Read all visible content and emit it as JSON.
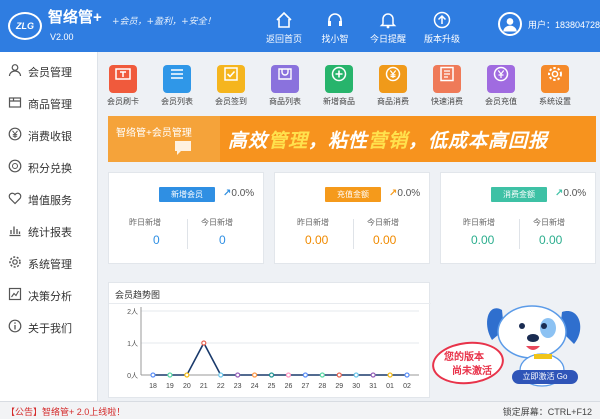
{
  "header": {
    "logo_text": "ZLG",
    "brand": "智络管+",
    "version": "V2.00",
    "slogan": "+会员，+盈利，+安全！",
    "nav": [
      {
        "label": "返回首页",
        "icon": "home-icon"
      },
      {
        "label": "找小智",
        "icon": "headset-icon"
      },
      {
        "label": "今日提醒",
        "icon": "bell-icon"
      },
      {
        "label": "版本升级",
        "icon": "upgrade-icon"
      }
    ],
    "user": "用户：18380472862"
  },
  "sidebar": {
    "items": [
      {
        "label": "会员管理",
        "icon": "person-icon"
      },
      {
        "label": "商品管理",
        "icon": "box-icon"
      },
      {
        "label": "消费收银",
        "icon": "yen-icon"
      },
      {
        "label": "积分兑换",
        "icon": "coin-icon"
      },
      {
        "label": "增值服务",
        "icon": "heart-icon"
      },
      {
        "label": "统计报表",
        "icon": "chart-icon"
      },
      {
        "label": "系统管理",
        "icon": "gear-icon"
      },
      {
        "label": "决策分析",
        "icon": "decision-icon"
      },
      {
        "label": "关于我们",
        "icon": "info-icon"
      }
    ]
  },
  "shortcuts": [
    {
      "label": "会员刷卡",
      "color": "#f05a3c",
      "icon": "card-reader-icon"
    },
    {
      "label": "会员列表",
      "color": "#2f97e8",
      "icon": "list-icon"
    },
    {
      "label": "会员签到",
      "color": "#f5b51e",
      "icon": "checkin-icon"
    },
    {
      "label": "商品列表",
      "color": "#8a72dd",
      "icon": "cart-icon"
    },
    {
      "label": "新增商品",
      "color": "#27b46c",
      "icon": "plus-circle-icon"
    },
    {
      "label": "商品消费",
      "color": "#f09a1a",
      "icon": "yen-circle-icon"
    },
    {
      "label": "快速消费",
      "color": "#ef7a58",
      "icon": "quick-pay-icon"
    },
    {
      "label": "会员充值",
      "color": "#a06be0",
      "icon": "recharge-icon"
    },
    {
      "label": "系统设置",
      "color": "#f58a2a",
      "icon": "settings-icon"
    }
  ],
  "banner": {
    "small": "智络管+会员管理",
    "big_parts": [
      "高效",
      "管理",
      "，粘性",
      "营销",
      "，低成本高回报"
    ]
  },
  "stats": [
    {
      "button": "新增会员",
      "color": "#2f8fe3",
      "pct": "0.0%",
      "yesterday_label": "昨日新增",
      "today_label": "今日新增",
      "yesterday": "0",
      "today": "0",
      "value_color": "#2f8fe3"
    },
    {
      "button": "充值金额",
      "color": "#f59a1b",
      "pct": "0.0%",
      "yesterday_label": "昨日新增",
      "today_label": "今日新增",
      "yesterday": "0.00",
      "today": "0.00",
      "value_color": "#f08a00"
    },
    {
      "button": "消费金额",
      "color": "#3ec1a5",
      "pct": "0.0%",
      "yesterday_label": "昨日新增",
      "today_label": "今日新增",
      "yesterday": "0.00",
      "today": "0.00",
      "value_color": "#2cae8e"
    }
  ],
  "mascot": {
    "line1": "您的版本",
    "line2": "尚未激活",
    "button": "立即激活 Go"
  },
  "footer": {
    "notice": "【公告】智络管+ 2.0上线啦！",
    "lock": "锁定屏幕：CTRL+F12"
  },
  "chart_data": {
    "type": "line",
    "title": "会员趋势图",
    "x": [
      "18",
      "19",
      "20",
      "21",
      "22",
      "23",
      "24",
      "25",
      "26",
      "27",
      "28",
      "29",
      "30",
      "31",
      "01",
      "02"
    ],
    "series": [
      {
        "values": [
          0,
          0,
          0,
          1,
          0,
          0,
          0,
          0,
          0,
          0,
          0,
          0,
          0,
          0,
          0,
          0
        ],
        "color": "#1a3a6b"
      }
    ],
    "point_colors": [
      "#5b8ff9",
      "#5ad8a6",
      "#f6bd16",
      "#e86452",
      "#6dc8ec",
      "#945fb9",
      "#ff9845",
      "#1e9493",
      "#ff99c3",
      "#5b8ff9",
      "#5ad8a6",
      "#e86452",
      "#6dc8ec",
      "#945fb9",
      "#f6bd16",
      "#5b8ff9"
    ],
    "y_ticks": [
      "0人",
      "1人",
      "2人"
    ],
    "ylim": [
      0,
      2
    ],
    "grid": true
  }
}
